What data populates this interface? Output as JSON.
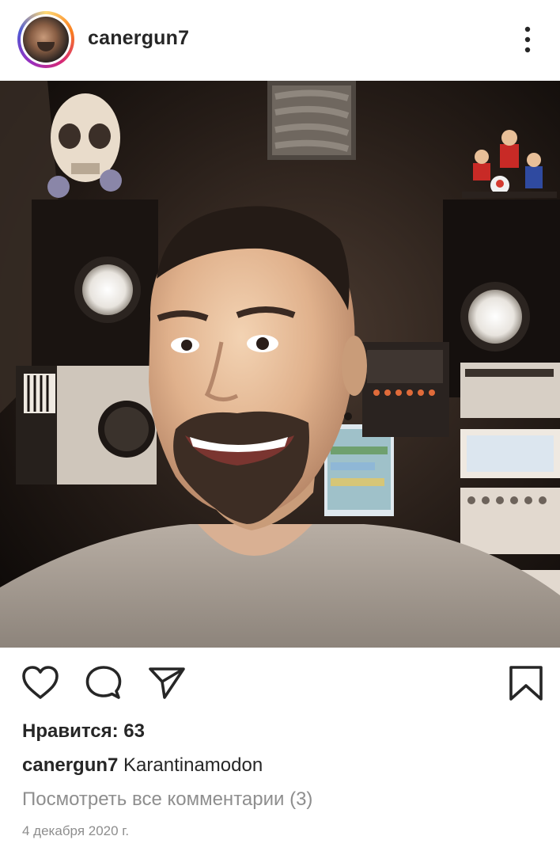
{
  "post": {
    "username": "canergun7",
    "likes_text": "Нравится: 63",
    "caption_author": "canergun7",
    "caption_text": "Karantinamodon",
    "view_comments": "Посмотреть все комментарии (3)",
    "date": "4 декабря 2020 г."
  },
  "icons": {
    "more": "more-vertical-icon",
    "like": "heart-icon",
    "comment": "comment-icon",
    "share": "send-icon",
    "save": "bookmark-icon"
  },
  "colors": {
    "text": "#262626",
    "secondary_text": "#8e8e8e",
    "background": "#ffffff"
  }
}
